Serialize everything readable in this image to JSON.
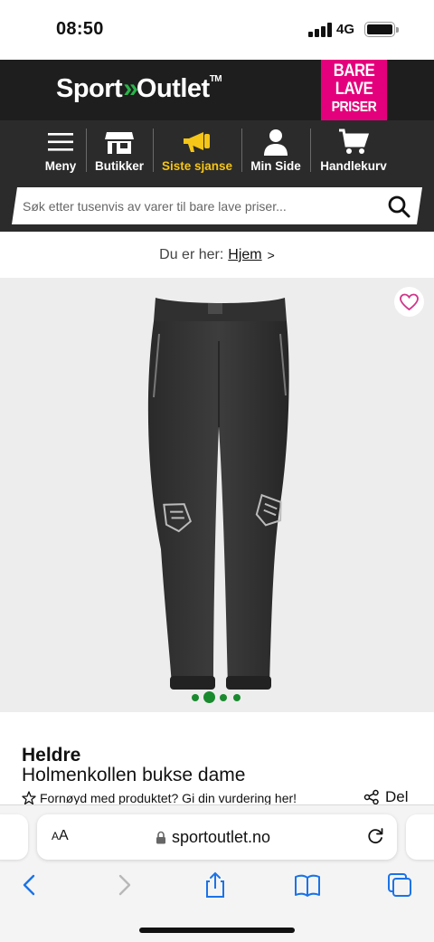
{
  "status_bar": {
    "time": "08:50",
    "network": "4G"
  },
  "header": {
    "logo_sport": "Sport",
    "logo_outlet": "Outlet",
    "logo_tm": "TM",
    "promo_lines": [
      "BARE",
      "LAVE",
      "PRISER"
    ],
    "promo_color": "#e4007c"
  },
  "nav": {
    "items": [
      {
        "label": "Meny",
        "icon": "hamburger-icon"
      },
      {
        "label": "Butikker",
        "icon": "store-icon"
      },
      {
        "label": "Siste sjanse",
        "icon": "megaphone-icon",
        "active": true
      },
      {
        "label": "Min Side",
        "icon": "user-icon"
      },
      {
        "label": "Handlekurv",
        "icon": "cart-icon"
      }
    ],
    "active_color": "#f5c518"
  },
  "search": {
    "placeholder": "Søk etter tusenvis av varer til bare lave priser..."
  },
  "breadcrumb": {
    "prefix": "Du er her:",
    "link": "Hjem",
    "chevron": ">"
  },
  "gallery": {
    "image_count": 4,
    "active_index": 1,
    "dot_color": "#1a8a2e"
  },
  "product": {
    "brand": "Heldre",
    "title": "Holmenkollen bukse dame",
    "rating_prompt": "Fornøyd med produktet? Gi din vurdering her!",
    "share_label": "Del"
  },
  "browser": {
    "text_size_label": "A",
    "text_size_small": "A",
    "url": "sportoutlet.no"
  }
}
